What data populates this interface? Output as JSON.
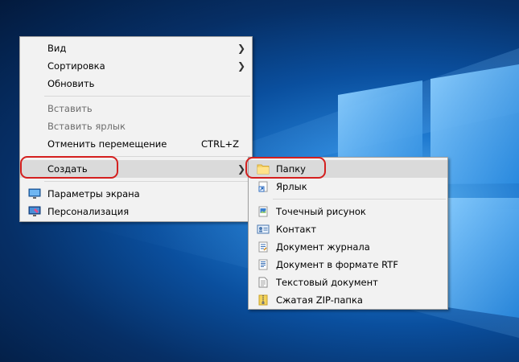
{
  "context_menu": {
    "items": [
      {
        "label": "Вид",
        "has_submenu": true
      },
      {
        "label": "Сортировка",
        "has_submenu": true
      },
      {
        "label": "Обновить"
      },
      {
        "label": "Вставить",
        "disabled": true
      },
      {
        "label": "Вставить ярлык",
        "disabled": true
      },
      {
        "label": "Отменить перемещение",
        "shortcut": "CTRL+Z"
      },
      {
        "label": "Создать",
        "has_submenu": true,
        "hovered": true
      },
      {
        "label": "Параметры экрана",
        "icon": "display-icon"
      },
      {
        "label": "Персонализация",
        "icon": "personalization-icon"
      }
    ]
  },
  "submenu_create": {
    "items": [
      {
        "label": "Папку",
        "icon": "folder-icon",
        "hovered": true
      },
      {
        "label": "Ярлык",
        "icon": "shortcut-icon"
      },
      {
        "label": "Точечный рисунок",
        "icon": "bitmap-icon"
      },
      {
        "label": "Контакт",
        "icon": "contact-icon"
      },
      {
        "label": "Документ журнала",
        "icon": "journal-icon"
      },
      {
        "label": "Документ в формате RTF",
        "icon": "rtf-document-icon"
      },
      {
        "label": "Текстовый документ",
        "icon": "text-document-icon"
      },
      {
        "label": "Сжатая ZIP-папка",
        "icon": "zip-folder-icon"
      }
    ]
  },
  "colors": {
    "annotation_red": "#d4201f",
    "menu_background": "#f2f2f2",
    "hover_background": "#dadada"
  }
}
